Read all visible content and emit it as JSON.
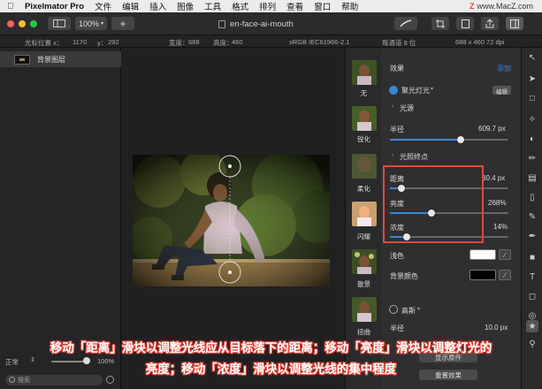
{
  "menubar": {
    "app_name": "Pixelmator Pro",
    "items": [
      "文件",
      "编辑",
      "插入",
      "图像",
      "工具",
      "格式",
      "排列",
      "查看",
      "窗口",
      "帮助"
    ],
    "watermark": "www.MacZ.com"
  },
  "toolbar": {
    "zoom": "100%",
    "add_label": "+",
    "document_title": "en-face-ai-mouth"
  },
  "infobar": {
    "cursor_label": "光标位置 x：",
    "cursor_x": "1170",
    "cursor_y_label": "y：",
    "cursor_y": "292",
    "width_label": "宽度：",
    "width": "688",
    "height_label": "高度：",
    "height": "460",
    "color_profile": "sRGB IEC61966-2.1",
    "bit_depth": "每通道 8 位",
    "size_dpi": "688 x 460 72 dpi"
  },
  "layers": {
    "items": [
      {
        "name": "背景图层"
      }
    ],
    "blend_mode": "正常",
    "opacity": "100%",
    "opacity_value": 0.95,
    "search_placeholder": "搜索"
  },
  "effects_browser": {
    "items": [
      {
        "label": "无"
      },
      {
        "label": "锐化"
      },
      {
        "label": "柔化"
      },
      {
        "label": "闪耀"
      },
      {
        "label": "散景"
      },
      {
        "label": "扭曲"
      }
    ]
  },
  "effects_panel": {
    "header": "效果",
    "add": "添加",
    "effect_name": "聚光灯光",
    "edit_badge": "编辑",
    "light_source_section": "光源",
    "radius_label": "半径",
    "radius_value": "609.7 px",
    "radius_fraction": 0.6,
    "endpoint_section": "光照终点",
    "distance_label": "距离",
    "distance_value": "30.4 px",
    "distance_fraction": 0.1,
    "brightness_label": "亮度",
    "brightness_value": "268%",
    "brightness_fraction": 0.35,
    "density_label": "浓度",
    "density_value": "14%",
    "density_fraction": 0.14,
    "light_color_label": "浅色",
    "light_color": "#ffffff",
    "bg_color_label": "背景颜色",
    "bg_color": "#000000",
    "gaussian_name": "高斯",
    "gaussian_radius_label": "半径",
    "gaussian_radius_value": "10.0 px",
    "show_original": "显示原件",
    "reset": "重置效果"
  },
  "colors": {
    "accent": "#3a86d8",
    "highlight_box": "#e2473c"
  },
  "caption": {
    "line1": "移动「距离」滑块以调整光线应从目标落下的距离；移动「亮度」滑块以调整灯光的",
    "line2": "亮度；移动「浓度」滑块以调整光线的集中程度"
  }
}
